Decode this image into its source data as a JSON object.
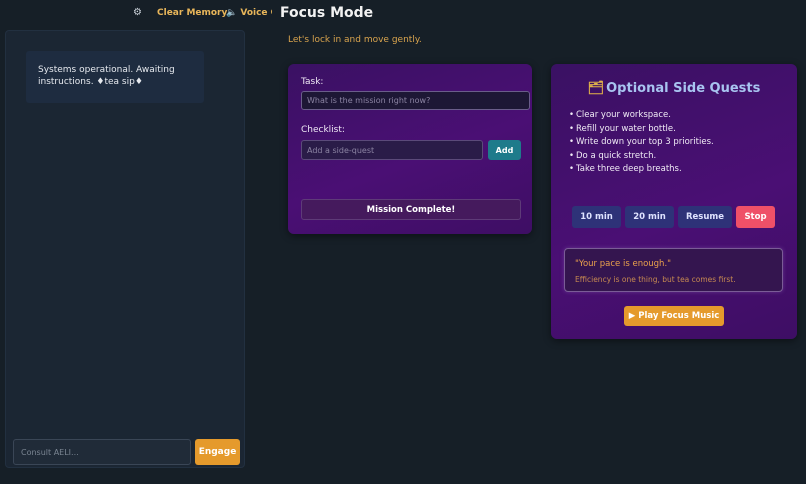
{
  "header": {
    "gear_glyph": "⚙",
    "clear_memory_label": "Clear Memory",
    "speaker_glyph": "🔈",
    "voice_label": "Voice On",
    "page_title": "Focus Mode",
    "subtitle": "Let's lock in and move gently."
  },
  "chat": {
    "messages": [
      {
        "text": "Systems operational. Awaiting instructions. ♦tea sip♦"
      }
    ],
    "input_placeholder": "Consult AELI...",
    "engage_label": "Engage"
  },
  "task": {
    "task_label": "Task:",
    "task_placeholder": "What is the mission right now?",
    "checklist_label": "Checklist:",
    "side_quest_placeholder": "Add a side-quest",
    "add_label": "Add",
    "complete_label": "Mission Complete!"
  },
  "side_quests": {
    "folder_glyph": "🗂",
    "title": "Optional Side Quests",
    "items": [
      "Clear your workspace.",
      "Refill your water bottle.",
      "Write down your top 3 priorities.",
      "Do a quick stretch.",
      "Take three deep breaths."
    ],
    "timer_buttons": {
      "ten": "10 min",
      "twenty": "20 min",
      "resume": "Resume",
      "stop": "Stop"
    },
    "quote": "\"Your pace is enough.\"",
    "quote_sub": "Efficiency is one thing, but tea comes first.",
    "music_glyph": "▶",
    "music_label": "Play Focus Music"
  },
  "colors": {
    "background": "#161f27",
    "accent_orange": "#e59a2c",
    "card_purple": "#4a0f74",
    "add_teal": "#1e7b8b",
    "stop_red": "#ef5068",
    "timer_blue": "#2e3278"
  }
}
